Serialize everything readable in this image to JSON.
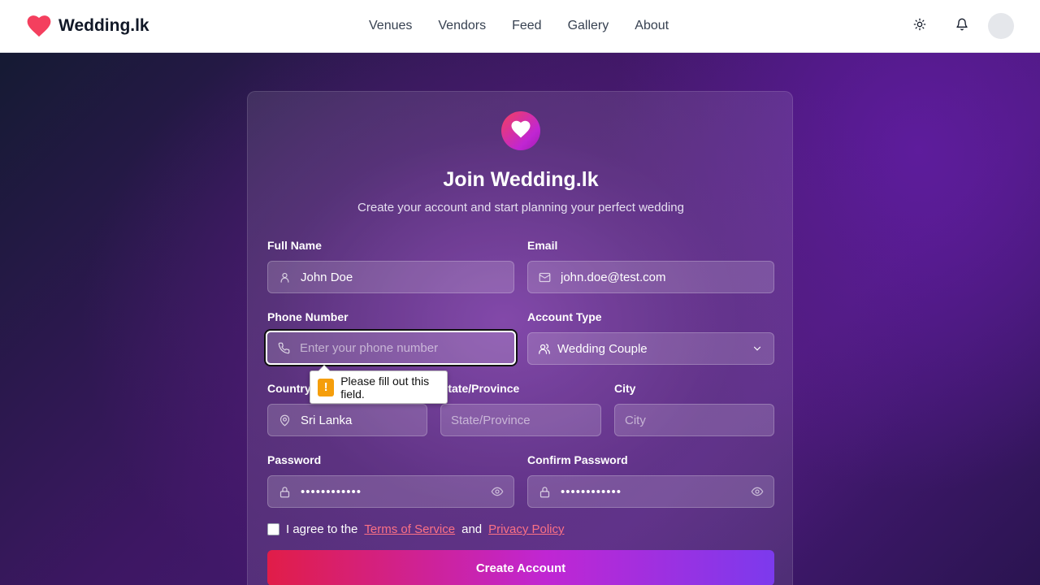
{
  "header": {
    "brand": "Wedding.lk",
    "nav": [
      "Venues",
      "Vendors",
      "Feed",
      "Gallery",
      "About"
    ],
    "icons": {
      "logo": "heart-icon",
      "theme": "sun-icon",
      "notifications": "bell-icon"
    }
  },
  "form": {
    "title": "Join Wedding.lk",
    "subtitle": "Create your account and start planning your perfect wedding",
    "full_name": {
      "label": "Full Name",
      "value": "John Doe",
      "icon": "user-icon"
    },
    "email": {
      "label": "Email",
      "value": "john.doe@test.com",
      "icon": "mail-icon"
    },
    "phone": {
      "label": "Phone Number",
      "value": "",
      "placeholder": "Enter your phone number",
      "icon": "phone-icon"
    },
    "account_type": {
      "label": "Account Type",
      "value": "Wedding Couple",
      "icon": "users-icon"
    },
    "country": {
      "label": "Country",
      "value": "Sri Lanka",
      "icon": "map-pin-icon"
    },
    "state": {
      "label": "State/Province",
      "value": "",
      "placeholder": "State/Province"
    },
    "city": {
      "label": "City",
      "value": "",
      "placeholder": "City"
    },
    "password": {
      "label": "Password",
      "value": "••••••••••••",
      "icon": "lock-icon"
    },
    "confirm_password": {
      "label": "Confirm Password",
      "value": "••••••••••••",
      "icon": "lock-icon"
    },
    "agree": {
      "prefix": "I agree to the",
      "terms": "Terms of Service",
      "and": "and",
      "privacy": "Privacy Policy",
      "checked": false
    },
    "submit_label": "Create Account"
  },
  "validation_tooltip": {
    "text": "Please fill out this field.",
    "icon": "!"
  },
  "colors": {
    "accent_pink": "#e11d48",
    "accent_purple": "#7c3aed",
    "link": "#fb7185"
  }
}
